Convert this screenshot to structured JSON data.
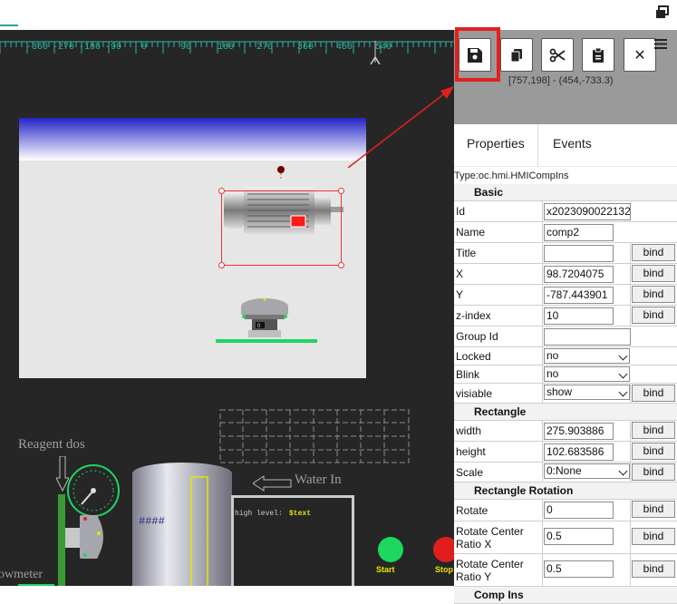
{
  "ruler": {
    "labels": [
      "-360",
      "-270",
      "-180",
      "-90",
      "0",
      "90",
      "180",
      "270",
      "360",
      "450",
      "540"
    ]
  },
  "canvas": {
    "labels": {
      "reagent": "Reagent dos",
      "water_in": "Water In",
      "flowmeter": "owmeter",
      "tank_text": "####",
      "high_level": "high level:",
      "high_level_value": "$text",
      "start": "Start",
      "stop": "Stop",
      "pump_value": "0"
    },
    "colors": {
      "background": "#262626",
      "stage": "#e6e6e6",
      "selection": "#e53935",
      "start_button": "#1ed760",
      "stop_button": "#e01e1e",
      "pipe": "#3a9a35"
    }
  },
  "toolbar": {
    "buttons": [
      {
        "icon": "save-icon",
        "label": "Save"
      },
      {
        "icon": "copy-icon",
        "label": "Copy"
      },
      {
        "icon": "cut-icon",
        "label": "Cut"
      },
      {
        "icon": "paste-icon",
        "label": "Paste"
      },
      {
        "icon": "close-icon",
        "label": "Delete"
      }
    ],
    "coords": "[757,198] - (454,-733.3)"
  },
  "tabs": [
    "Properties",
    "Events"
  ],
  "type_line": "Type:oc.hmi.HMICompIns",
  "properties": {
    "sections": {
      "basic": "Basic",
      "rectangle": "Rectangle",
      "rotation": "Rectangle Rotation",
      "comp_ins": "Comp Ins"
    },
    "bind_label": "bind",
    "id": {
      "label": "Id",
      "value": "x2023090022132"
    },
    "name": {
      "label": "Name",
      "value": "comp2"
    },
    "title": {
      "label": "Title",
      "value": ""
    },
    "x": {
      "label": "X",
      "value": "98.7204075"
    },
    "y": {
      "label": "Y",
      "value": "-787.443901"
    },
    "zindex": {
      "label": "z-index",
      "value": "10"
    },
    "group_id": {
      "label": "Group Id",
      "value": ""
    },
    "locked": {
      "label": "Locked",
      "value": "no"
    },
    "blink": {
      "label": "Blink",
      "value": "no"
    },
    "visiable": {
      "label": "visiable",
      "value": "show"
    },
    "width": {
      "label": "width",
      "value": "275.903886"
    },
    "height": {
      "label": "height",
      "value": "102.683586"
    },
    "scale": {
      "label": "Scale",
      "value": "0:None"
    },
    "rotate": {
      "label": "Rotate",
      "value": "0"
    },
    "center_x": {
      "label_line1": "Rotate Center",
      "label_line2": "Ratio X",
      "value": "0.5"
    },
    "center_y": {
      "label_line1": "Rotate Center",
      "label_line2": "Ratio Y",
      "value": "0.5"
    }
  }
}
